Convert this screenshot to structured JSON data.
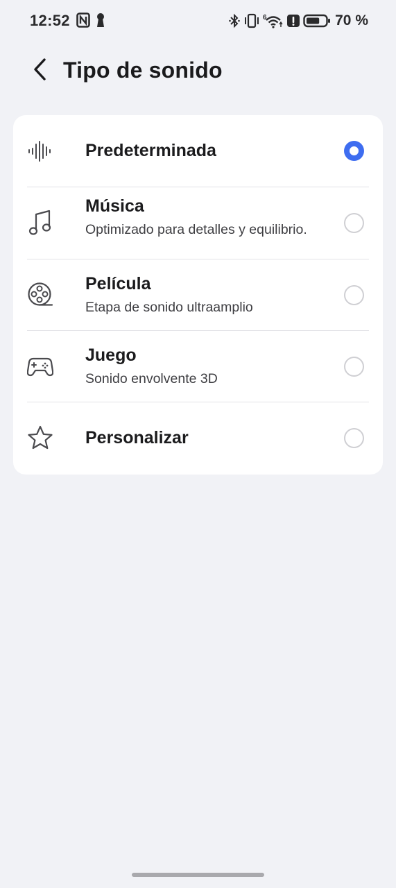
{
  "status_bar": {
    "time": "12:52",
    "battery_percent": "70 %",
    "battery_level": 0.7,
    "left_icons": [
      "nfc-icon",
      "keyhole-icon"
    ],
    "right_icons": [
      "bluetooth-icon",
      "vibrate-icon",
      "wifi-6-icon",
      "alert-icon",
      "battery-icon"
    ]
  },
  "header": {
    "back_icon": "chevron-left-icon",
    "title": "Tipo de sonido"
  },
  "options": [
    {
      "id": "predeterminada",
      "icon": "soundwave-icon",
      "title": "Predeterminada",
      "subtitle": "",
      "selected": true
    },
    {
      "id": "musica",
      "icon": "music-note-icon",
      "title": "Música",
      "subtitle": "Optimizado para detalles y equilibrio.",
      "selected": false
    },
    {
      "id": "pelicula",
      "icon": "film-reel-icon",
      "title": "Película",
      "subtitle": "Etapa de sonido ultraamplio",
      "selected": false
    },
    {
      "id": "juego",
      "icon": "gamepad-icon",
      "title": "Juego",
      "subtitle": "Sonido envolvente 3D",
      "selected": false
    },
    {
      "id": "personalizar",
      "icon": "star-icon",
      "title": "Personalizar",
      "subtitle": "",
      "selected": false
    }
  ],
  "colors": {
    "background": "#f1f2f6",
    "card": "#ffffff",
    "accent": "#3e6df0",
    "radio_border": "#cfcfd3"
  }
}
